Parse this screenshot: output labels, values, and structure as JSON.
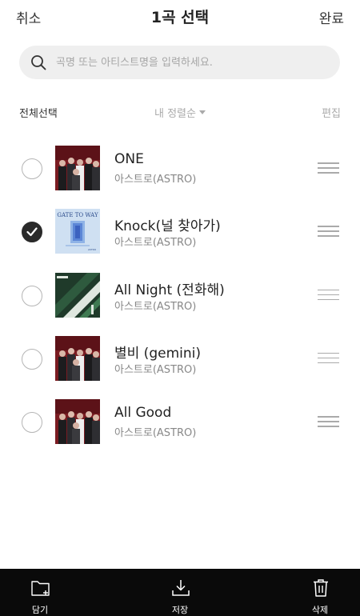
{
  "header": {
    "cancel_label": "취소",
    "title": "1곡 선택",
    "done_label": "완료"
  },
  "search": {
    "placeholder": "곡명 또는 아티스트명을 입력하세요.",
    "value": ""
  },
  "toolbar": {
    "select_all_label": "전체선택",
    "sort_label": "내 정렬순",
    "edit_label": "편집"
  },
  "songs": [
    {
      "title": "ONE",
      "artist": "아스트로(ASTRO)",
      "selected": false,
      "cover": "dark-red-group-photo"
    },
    {
      "title": "Knock(널 찾아가)",
      "artist": "아스트로(ASTRO)",
      "selected": true,
      "cover": "light-blue-gate-to-way"
    },
    {
      "title": "All Night (전화해)",
      "artist": "아스트로(ASTRO)",
      "selected": false,
      "cover": "dark-green-abstract"
    },
    {
      "title": "별비 (gemini)",
      "artist": "아스트로(ASTRO)",
      "selected": false,
      "cover": "dark-red-group-photo"
    },
    {
      "title": "All Good",
      "artist": "아스트로(ASTRO)",
      "selected": false,
      "cover": "dark-red-group-photo"
    }
  ],
  "cover_text": {
    "knock_cover_title": "GATE TO WAY",
    "knock_cover_brand": "ASTRO"
  },
  "bottom_bar": {
    "save_to_label": "담기",
    "download_label": "저장",
    "delete_label": "삭제"
  },
  "colors": {
    "checked": "#2a2a2a",
    "bottom_bar_bg": "#0a0a0a",
    "search_bg": "#efefef"
  }
}
